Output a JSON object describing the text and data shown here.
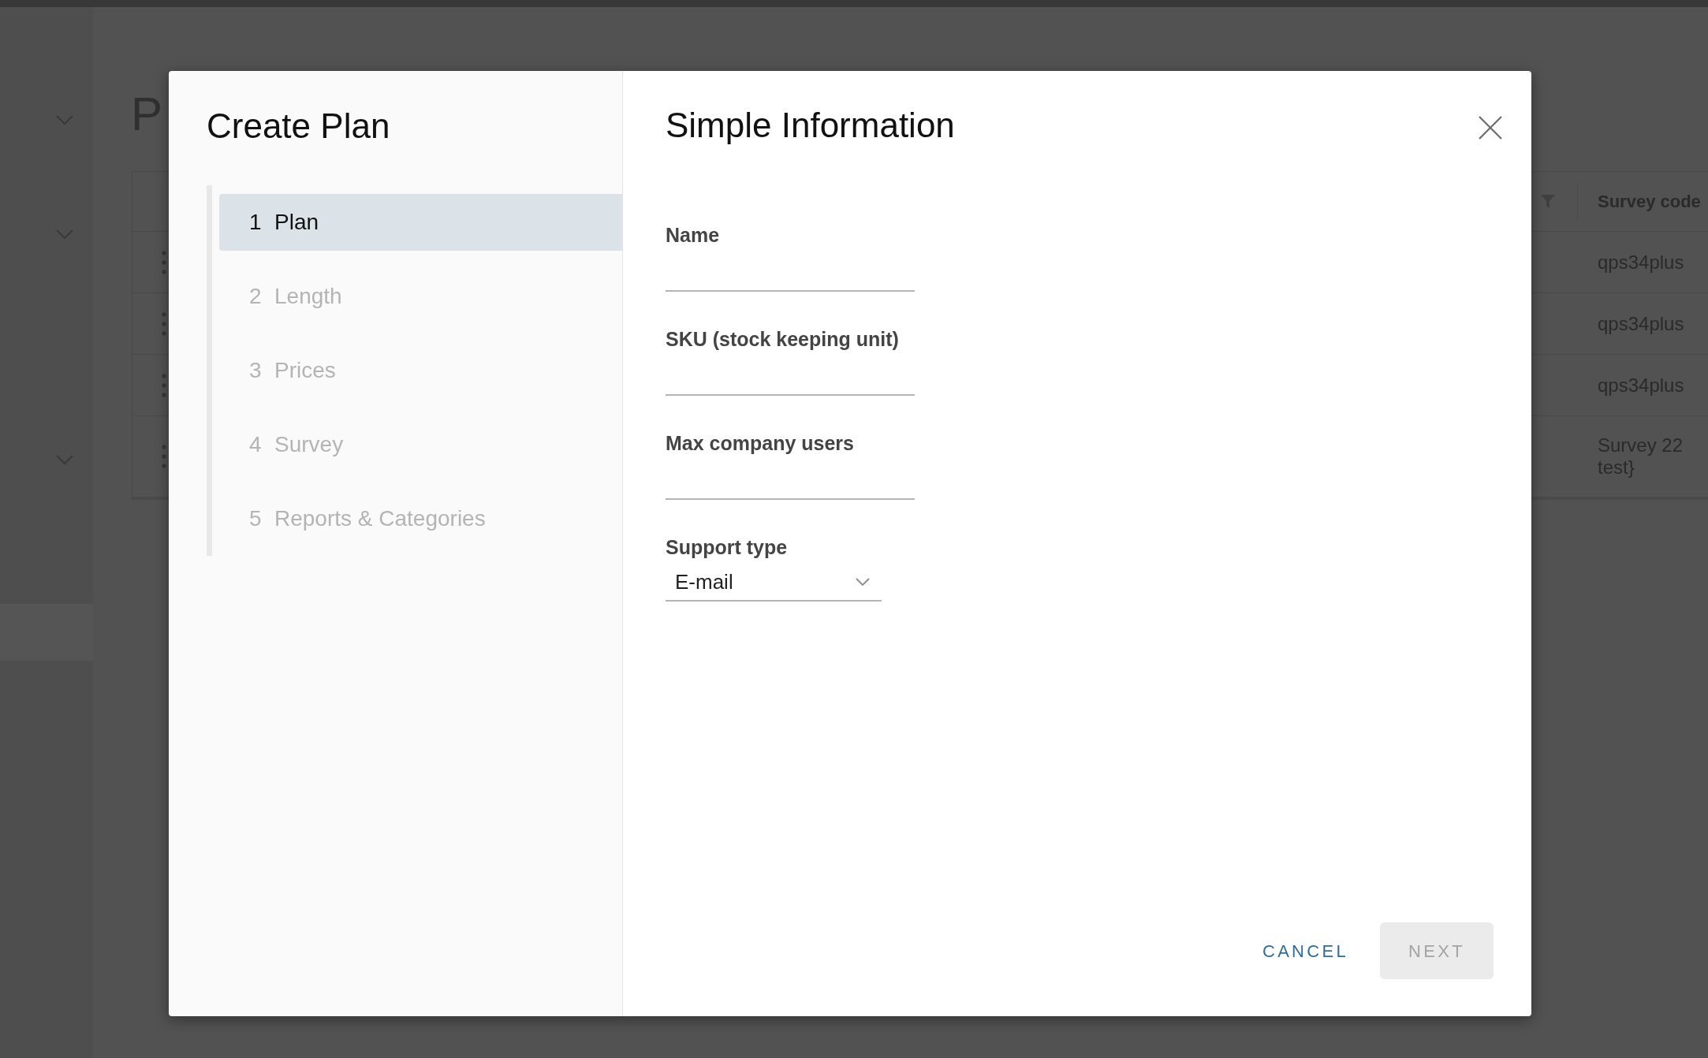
{
  "background": {
    "page_title": "P",
    "table": {
      "columns": [
        {
          "label": "Survey code"
        }
      ],
      "rows": [
        {
          "survey_code": "qps34plus"
        },
        {
          "survey_code": "qps34plus"
        },
        {
          "survey_code": "qps34plus"
        },
        {
          "survey_code": "Survey 22 test}"
        }
      ]
    }
  },
  "dialog": {
    "title": "Create Plan",
    "steps": [
      {
        "number": "1",
        "label": "Plan",
        "selected": true
      },
      {
        "number": "2",
        "label": "Length",
        "selected": false
      },
      {
        "number": "3",
        "label": "Prices",
        "selected": false
      },
      {
        "number": "4",
        "label": "Survey",
        "selected": false
      },
      {
        "number": "5",
        "label": "Reports & Categories",
        "selected": false
      }
    ],
    "section_title": "Simple Information",
    "fields": [
      {
        "kind": "text",
        "label": "Name"
      },
      {
        "kind": "text",
        "label": "SKU (stock keeping unit)"
      },
      {
        "kind": "text",
        "label": "Max company users"
      },
      {
        "kind": "select",
        "label": "Support type",
        "value": "E-mail"
      }
    ],
    "buttons": [
      {
        "kind": "flat",
        "label": "CANCEL",
        "disabled": false
      },
      {
        "kind": "filled",
        "label": "NEXT",
        "disabled": true
      }
    ]
  }
}
